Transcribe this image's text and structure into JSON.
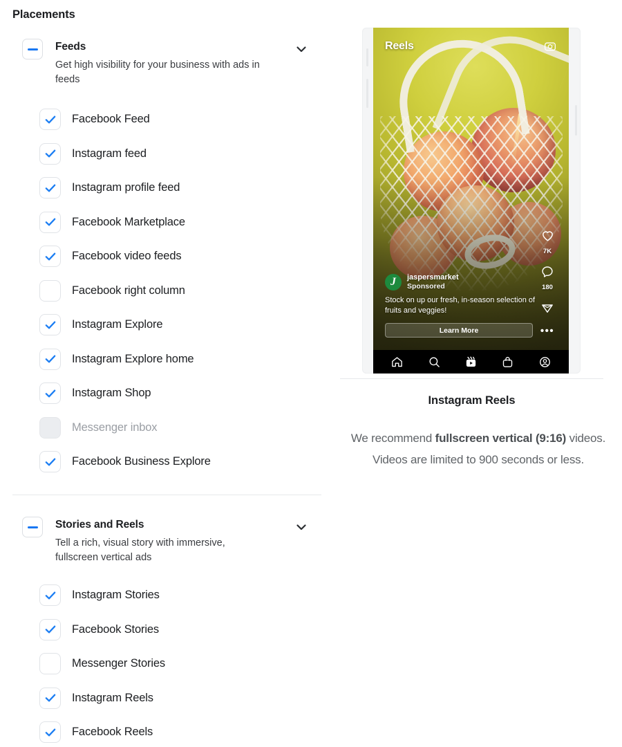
{
  "page": {
    "title": "Placements"
  },
  "groups": [
    {
      "id": "feeds",
      "title": "Feeds",
      "description": "Get high visibility for your business with ads in feeds",
      "collapse_icon": "minus-icon",
      "chevron_icon": "chevron-down-icon",
      "items": [
        {
          "label": "Facebook Feed",
          "state": "checked"
        },
        {
          "label": "Instagram feed",
          "state": "checked"
        },
        {
          "label": "Instagram profile feed",
          "state": "checked"
        },
        {
          "label": "Facebook Marketplace",
          "state": "checked"
        },
        {
          "label": "Facebook video feeds",
          "state": "checked"
        },
        {
          "label": "Facebook right column",
          "state": "unchecked"
        },
        {
          "label": "Instagram Explore",
          "state": "checked"
        },
        {
          "label": "Instagram Explore home",
          "state": "checked"
        },
        {
          "label": "Instagram Shop",
          "state": "checked"
        },
        {
          "label": "Messenger inbox",
          "state": "disabled"
        },
        {
          "label": "Facebook Business Explore",
          "state": "checked"
        }
      ]
    },
    {
      "id": "stories",
      "title": "Stories and Reels",
      "description": "Tell a rich, visual story with immersive, fullscreen vertical ads",
      "collapse_icon": "minus-icon",
      "chevron_icon": "chevron-down-icon",
      "items": [
        {
          "label": "Instagram Stories",
          "state": "checked"
        },
        {
          "label": "Facebook Stories",
          "state": "checked"
        },
        {
          "label": "Messenger Stories",
          "state": "unchecked"
        },
        {
          "label": "Instagram Reels",
          "state": "checked"
        },
        {
          "label": "Facebook Reels",
          "state": "checked"
        }
      ]
    }
  ],
  "preview": {
    "phone": {
      "screen_label": "Reels",
      "camera_icon": "camera-icon",
      "rail": [
        {
          "icon": "heart-icon",
          "count": "7K"
        },
        {
          "icon": "comment-icon",
          "count": "180"
        },
        {
          "icon": "share-icon",
          "count": ""
        },
        {
          "icon": "more-options-icon",
          "count": ""
        }
      ],
      "ad": {
        "brand_glyph": "J",
        "brand_name": "jaspersmarket",
        "sponsored_label": "Sponsored",
        "copy": "Stock on up our fresh, in-season selection of fruits and veggies!",
        "cta_label": "Learn More"
      },
      "nav": [
        "home-icon",
        "search-icon",
        "reels-icon",
        "shop-icon",
        "profile-icon"
      ]
    },
    "title": "Instagram Reels",
    "description_parts": {
      "p1": "We recommend ",
      "b1": "fullscreen vertical",
      "p2": " ",
      "b2": "(9:16)",
      "p3": " videos. Videos are limited to 900 seconds or less."
    }
  },
  "colors": {
    "accent_blue": "#1877f2",
    "check_blue": "#1c7ef3",
    "text_primary": "#1c1e21",
    "text_muted": "#9a9ea4",
    "divider": "#e6e8eb"
  }
}
